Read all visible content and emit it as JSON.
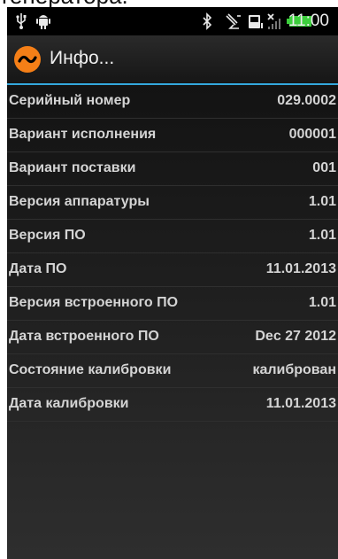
{
  "caption": "генератора.",
  "status_bar": {
    "time": "11:00",
    "icons": [
      "usb-icon",
      "android-debug-icon",
      "bluetooth-icon",
      "no-gps-icon",
      "sd-card-icon",
      "no-signal-icon",
      "battery-icon"
    ],
    "battery_color": "#3ccf3c"
  },
  "action_bar": {
    "title": "Инфо...",
    "app_icon": "tilde-wave-icon",
    "accent_color": "#33a7dc",
    "icon_color": "#f57f17"
  },
  "info_rows": [
    {
      "label": "Серийный номер",
      "value": "029.0002"
    },
    {
      "label": "Вариант исполнения",
      "value": "000001"
    },
    {
      "label": "Вариант поставки",
      "value": "001"
    },
    {
      "label": "Версия аппаратуры",
      "value": "1.01"
    },
    {
      "label": "Версия ПО",
      "value": "1.01"
    },
    {
      "label": "Дата ПО",
      "value": "11.01.2013"
    },
    {
      "label": "Версия встроенного ПО",
      "value": "1.01"
    },
    {
      "label": "Дата встроенного ПО",
      "value": "Dec 27 2012"
    },
    {
      "label": "Состояние калибровки",
      "value": "калиброван"
    },
    {
      "label": "Дата калибровки",
      "value": "11.01.2013"
    }
  ]
}
